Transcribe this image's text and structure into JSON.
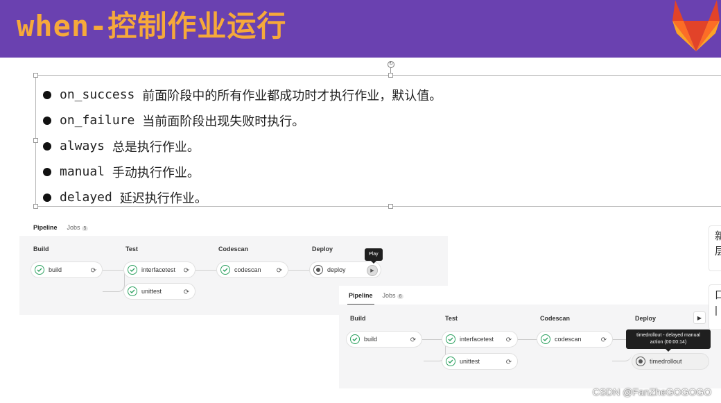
{
  "header": {
    "title": "when-控制作业运行",
    "bg_color": "#6a41b0",
    "title_color": "#f6a93a",
    "logo_icon": "gitlab-logo"
  },
  "bullets": [
    {
      "keyword": "on_success",
      "text": "前面阶段中的所有作业都成功时才执行作业，默认值。"
    },
    {
      "keyword": "on_failure",
      "text": "当前面阶段出现失败时执行。"
    },
    {
      "keyword": "always",
      "text": "总是执行作业。"
    },
    {
      "keyword": "manual",
      "text": "手动执行作业。"
    },
    {
      "keyword": "delayed",
      "text": "延迟执行作业。"
    }
  ],
  "pipeline1": {
    "tabs": [
      {
        "label": "Pipeline"
      },
      {
        "label": "Jobs",
        "count": "5"
      }
    ],
    "stages": [
      "Build",
      "Test",
      "Codescan",
      "Deploy"
    ],
    "jobs": {
      "build": "build",
      "interfacetest": "interfacetest",
      "unittest": "unittest",
      "codescan": "codescan",
      "deploy": "deploy"
    },
    "tooltip": "Play"
  },
  "pipeline2": {
    "tabs": [
      {
        "label": "Pipeline"
      },
      {
        "label": "Jobs",
        "count": "6"
      }
    ],
    "stages": [
      "Build",
      "Test",
      "Codescan",
      "Deploy"
    ],
    "jobs": {
      "build": "build",
      "interfacetest": "interfacetest",
      "unittest": "unittest",
      "codescan": "codescan",
      "timedrollout": "timedrollout"
    },
    "tooltip": "timedrollout - delayed manual action (00:00:14)"
  },
  "side": {
    "card1": "新\n层",
    "card2": "口\n|"
  },
  "watermark": "CSDN @FanZheGOGOGO"
}
